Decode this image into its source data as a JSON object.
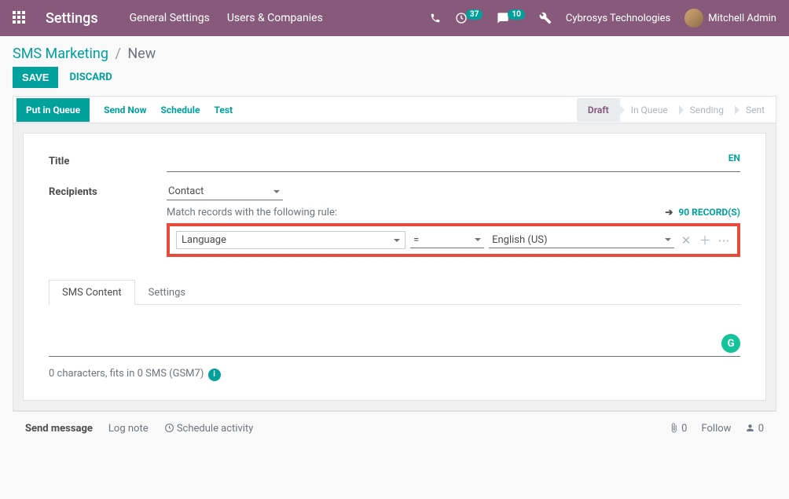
{
  "header": {
    "title": "Settings",
    "nav": {
      "general": "General Settings",
      "users": "Users & Companies"
    },
    "badges": {
      "activities": "37",
      "messages": "10"
    },
    "company": "Cybrosys Technologies",
    "user": "Mitchell Admin"
  },
  "breadcrumb": {
    "root": "SMS Marketing",
    "sep": "/",
    "current": "New"
  },
  "actions": {
    "save": "Save",
    "discard": "Discard"
  },
  "statusbar": {
    "put_in_queue": "Put in Queue",
    "send_now": "Send Now",
    "schedule": "Schedule",
    "test": "Test",
    "steps": {
      "draft": "Draft",
      "in_queue": "In Queue",
      "sending": "Sending",
      "sent": "Sent"
    }
  },
  "form": {
    "title_label": "Title",
    "title_value": "",
    "lang": "EN",
    "recipients_label": "Recipients",
    "recipients_value": "Contact",
    "match_label": "Match records with the following rule:",
    "records_link": "90 RECORD(S)",
    "rule": {
      "field": "Language",
      "op": "=",
      "value": "English (US)"
    },
    "tabs": {
      "content": "SMS Content",
      "settings": "Settings"
    },
    "char_count": "0 characters, fits in 0 SMS (GSM7)",
    "grammarly": "G"
  },
  "chatter": {
    "send_message": "Send message",
    "log_note": "Log note",
    "schedule_activity": "Schedule activity",
    "attachments": "0",
    "follow": "Follow",
    "followers": "0"
  }
}
